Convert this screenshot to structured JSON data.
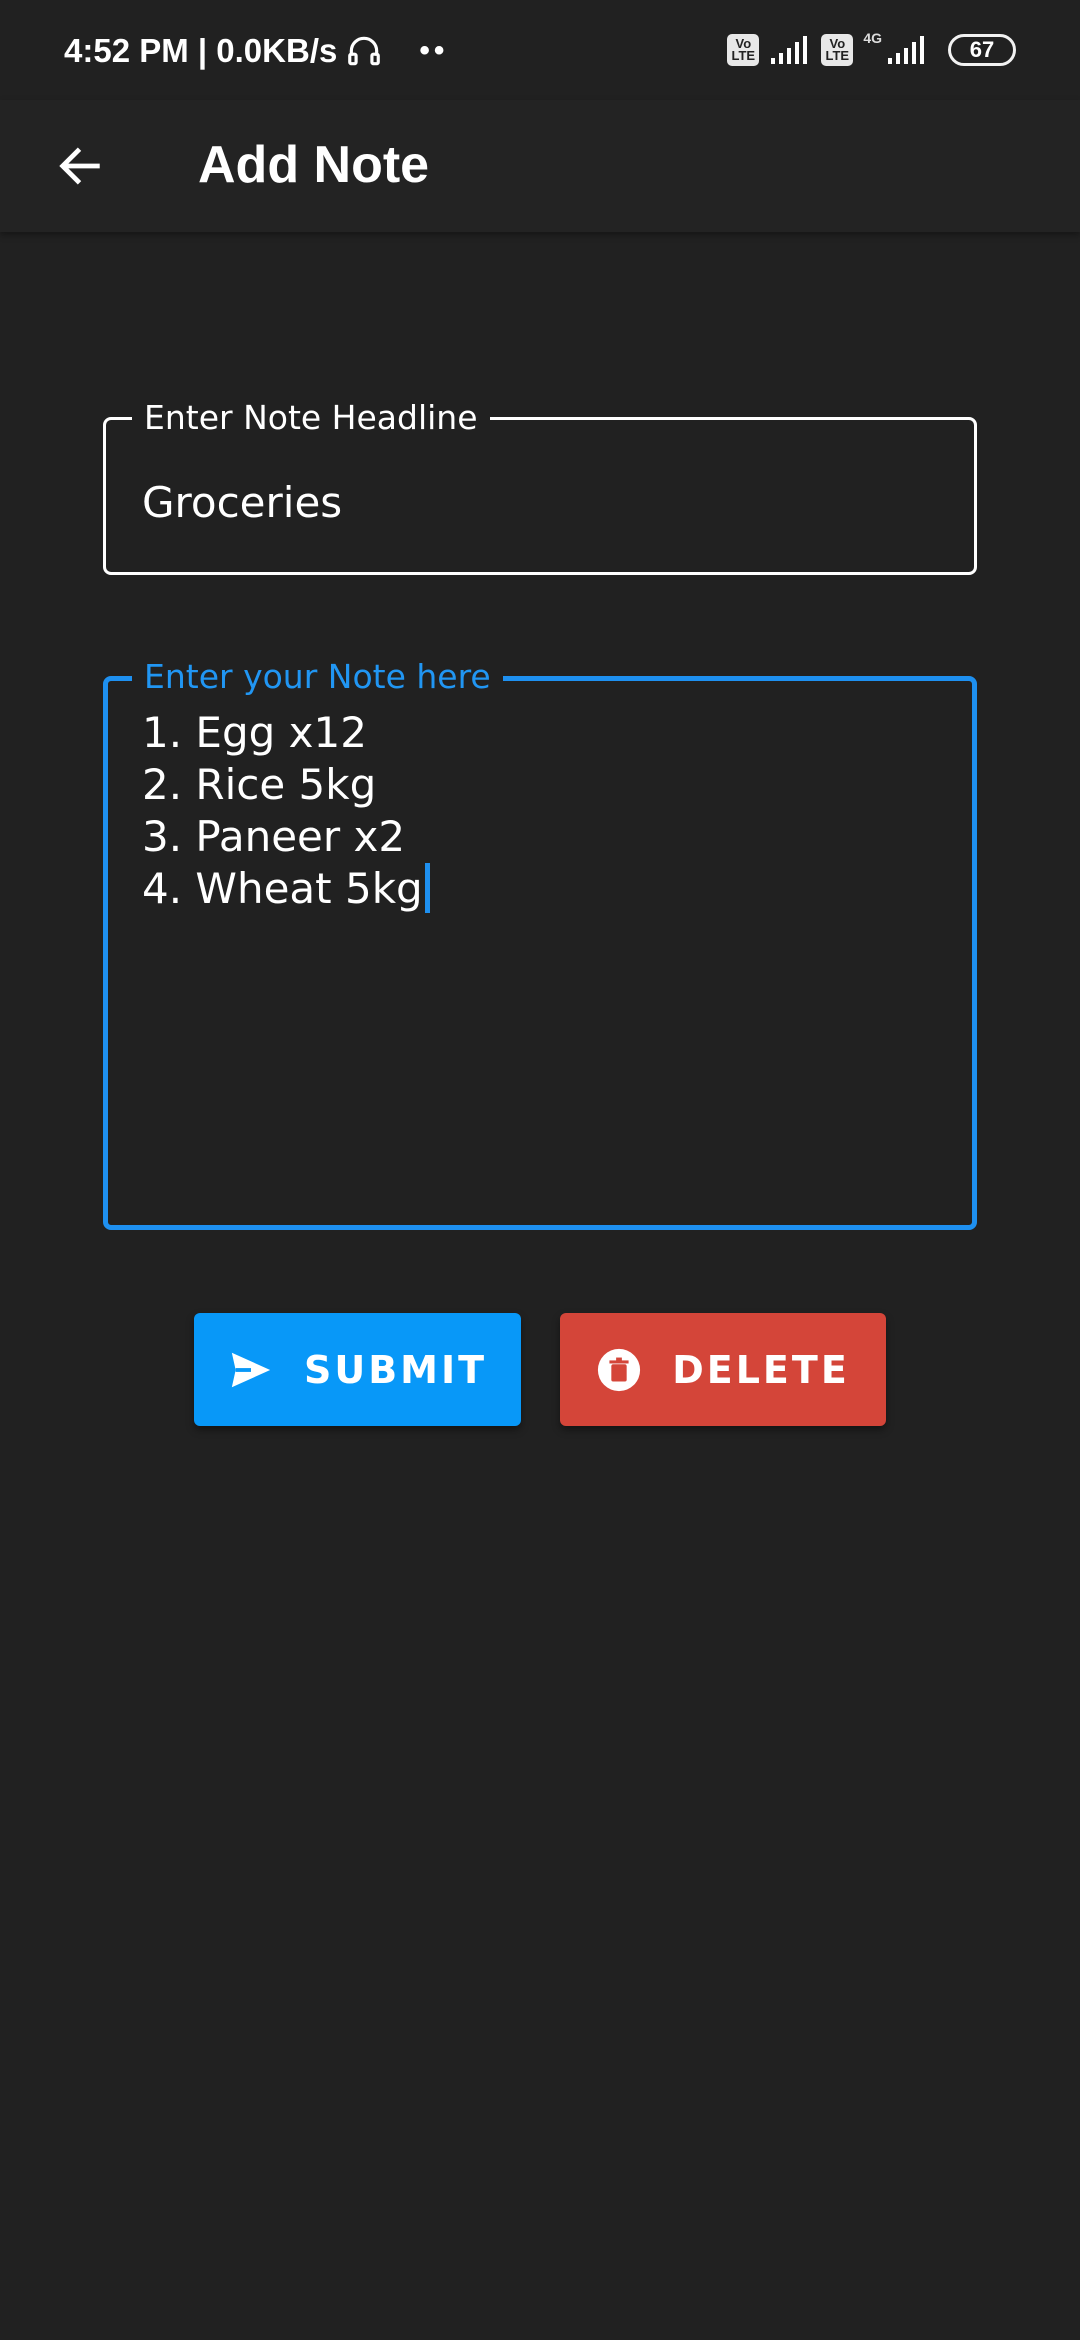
{
  "status_bar": {
    "time_speed": "4:52 PM | 0.0KB/s",
    "dots": "••",
    "volte1": "Vo\nLTE",
    "volte2": "Vo\nLTE",
    "network": "4G",
    "battery": "67"
  },
  "app_bar": {
    "back_icon": "arrow-left-icon",
    "title": "Add Note"
  },
  "headline_field": {
    "label": "Enter Note Headline",
    "value": "Groceries"
  },
  "note_field": {
    "label": "Enter your Note here",
    "lines": [
      "1. Egg x12",
      "2. Rice 5kg",
      "3. Paneer x2",
      "4. Wheat 5kg"
    ]
  },
  "buttons": {
    "submit_label": "SUBMIT",
    "submit_icon": "send-icon",
    "delete_label": "DELETE",
    "delete_icon": "trash-icon"
  },
  "colors": {
    "background": "#212121",
    "accent": "#1e90f0",
    "submit": "#0898f8",
    "delete": "#d44539"
  }
}
